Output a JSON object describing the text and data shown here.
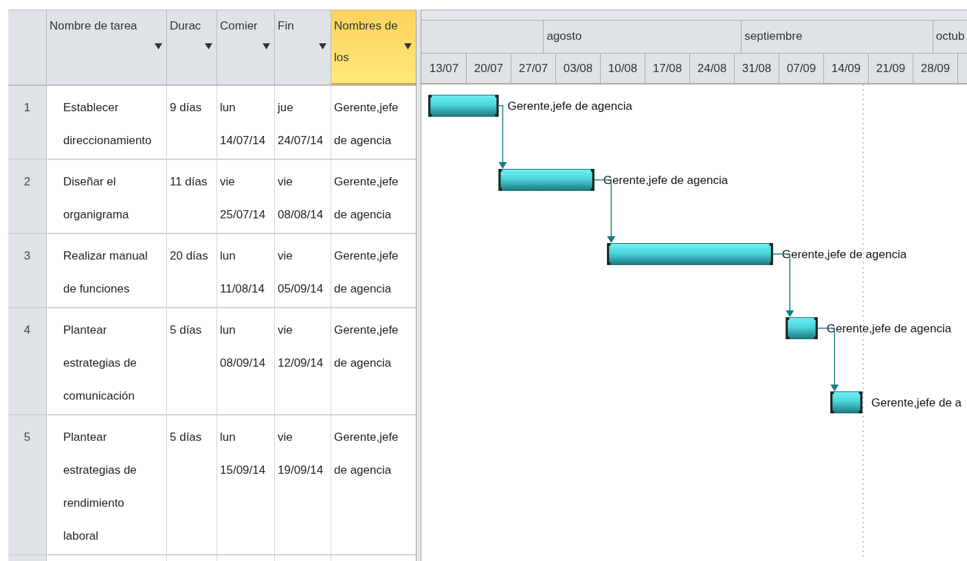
{
  "columns": [
    {
      "label": "Nombre de tarea",
      "selected": false
    },
    {
      "label": "Durac",
      "selected": false
    },
    {
      "label": "Comier",
      "selected": false
    },
    {
      "label": "Fin",
      "selected": false
    },
    {
      "label": "Nombres de los",
      "selected": true
    }
  ],
  "tasks": [
    {
      "id": "1",
      "name": "Establecer direccionamiento",
      "duration": "9 días",
      "start": "lun 14/07/14",
      "finish": "jue 24/07/14",
      "resources": "Gerente,jefe de agencia",
      "bar_label": "Gerente,jefe de agencia"
    },
    {
      "id": "2",
      "name": "Diseñar el organigrama",
      "duration": "11 días",
      "start": "vie 25/07/14",
      "finish": "vie 08/08/14",
      "resources": "Gerente,jefe de agencia",
      "bar_label": "Gerente,jefe de agencia"
    },
    {
      "id": "3",
      "name": "Realizar manual de funciones",
      "duration": "20 días",
      "start": "lun 11/08/14",
      "finish": "vie 05/09/14",
      "resources": "Gerente,jefe de agencia",
      "bar_label": "Gerente,jefe de agencia"
    },
    {
      "id": "4",
      "name": "Plantear estrategias de comunicación",
      "duration": "5 días",
      "start": "lun 08/09/14",
      "finish": "vie 12/09/14",
      "resources": "Gerente,jefe de agencia",
      "bar_label": "Gerente,jefe de agencia"
    },
    {
      "id": "5",
      "name": "Plantear estrategias de rendimiento laboral",
      "duration": "5 días",
      "start": "lun 15/09/14",
      "finish": "vie 19/09/14",
      "resources": "Gerente,jefe de agencia",
      "bar_label": "Gerente,jefe de a"
    }
  ],
  "timescale": {
    "months": [
      "agosto",
      "septiembre",
      "octub"
    ],
    "weeks": [
      "13/07",
      "20/07",
      "27/07",
      "03/08",
      "10/08",
      "17/08",
      "24/08",
      "31/08",
      "07/09",
      "14/09",
      "21/09",
      "28/09"
    ]
  }
}
